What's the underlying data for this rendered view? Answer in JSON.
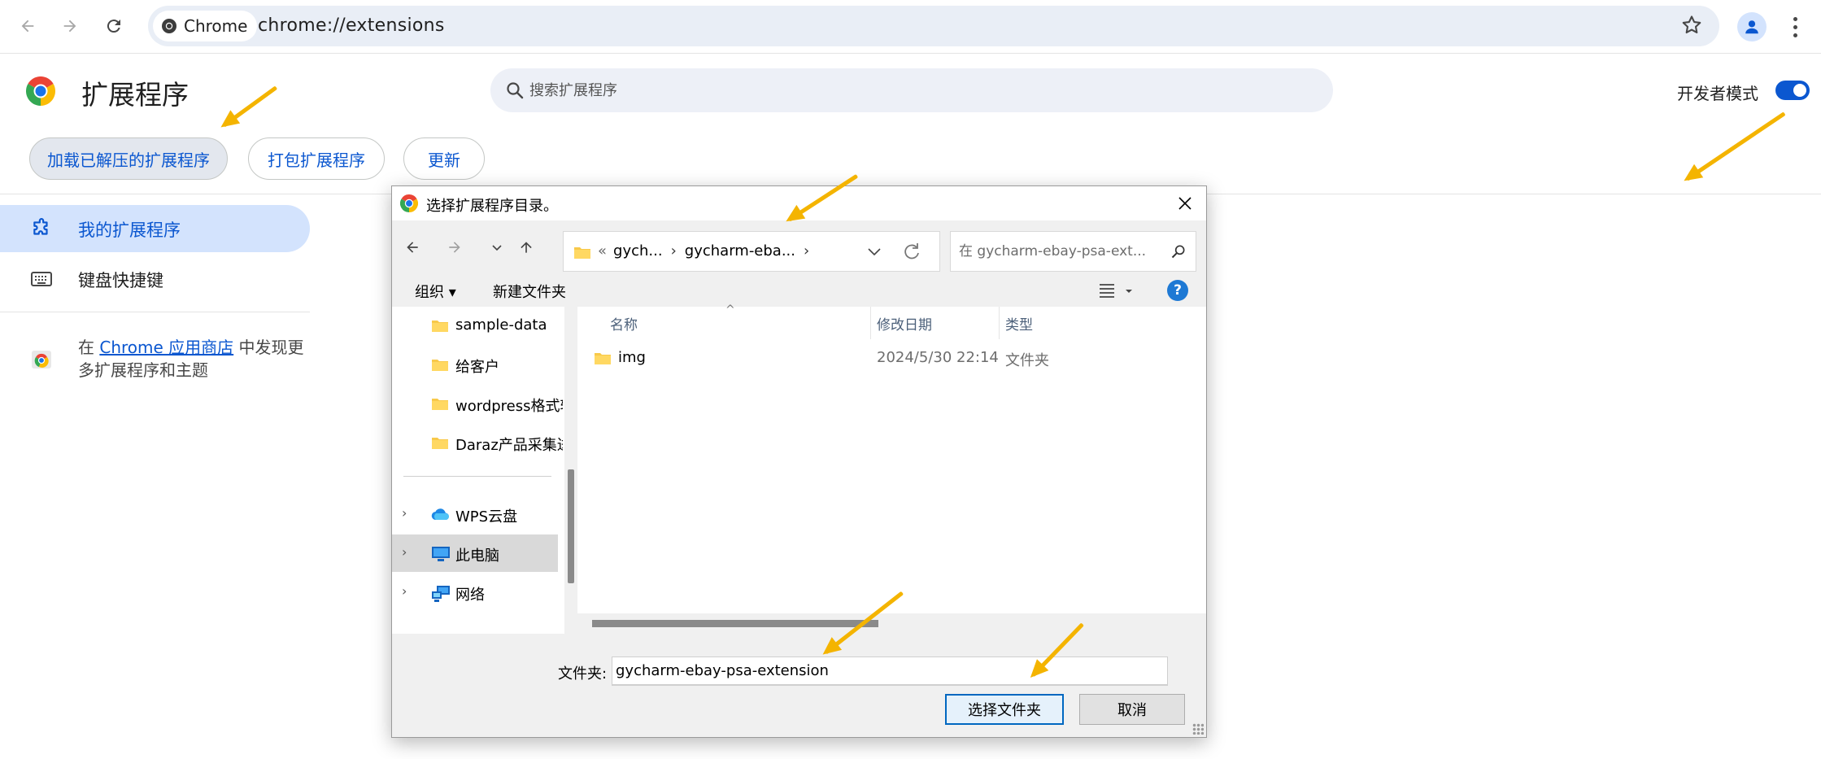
{
  "browser": {
    "chip_label": "Chrome",
    "url": "chrome://extensions"
  },
  "extensions_page": {
    "title": "扩展程序",
    "search_placeholder": "搜索扩展程序",
    "dev_mode_label": "开发者模式",
    "dev_mode_on": true,
    "buttons": {
      "load_unpacked": "加载已解压的扩展程序",
      "pack": "打包扩展程序",
      "update": "更新"
    },
    "sidebar": {
      "items": [
        {
          "label": "我的扩展程序",
          "selected": true
        },
        {
          "label": "键盘快捷键",
          "selected": false
        }
      ],
      "store_prefix": "在 ",
      "store_link": "Chrome 应用商店",
      "store_suffix": " 中发现更多扩展程序和主题"
    }
  },
  "dialog": {
    "title": "选择扩展程序目录。",
    "breadcrumb": {
      "overflow": "«",
      "items": [
        "gych...",
        "gycharm-eba..."
      ]
    },
    "search_placeholder": "在 gycharm-ebay-psa-ext...",
    "commands": {
      "organize": "组织 ▾",
      "new_folder": "新建文件夹"
    },
    "nav_pane": {
      "folders": [
        "sample-data",
        "给客户",
        "wordpress格式转",
        "Daraz产品采集进"
      ],
      "locations": [
        {
          "label": "WPS云盘",
          "icon": "cloud-icon",
          "selected": false
        },
        {
          "label": "此电脑",
          "icon": "computer-icon",
          "selected": true
        },
        {
          "label": "网络",
          "icon": "network-icon",
          "selected": false
        }
      ]
    },
    "columns": {
      "name": "名称",
      "modified": "修改日期",
      "type": "类型"
    },
    "files": [
      {
        "name": "img",
        "modified": "2024/5/30 22:14",
        "type": "文件夹"
      }
    ],
    "folder_label": "文件夹:",
    "folder_value": "gycharm-ebay-psa-extension",
    "select_button": "选择文件夹",
    "cancel_button": "取消"
  },
  "colors": {
    "accent": "#0b57d0",
    "annotation_arrow": "#f4b400"
  }
}
